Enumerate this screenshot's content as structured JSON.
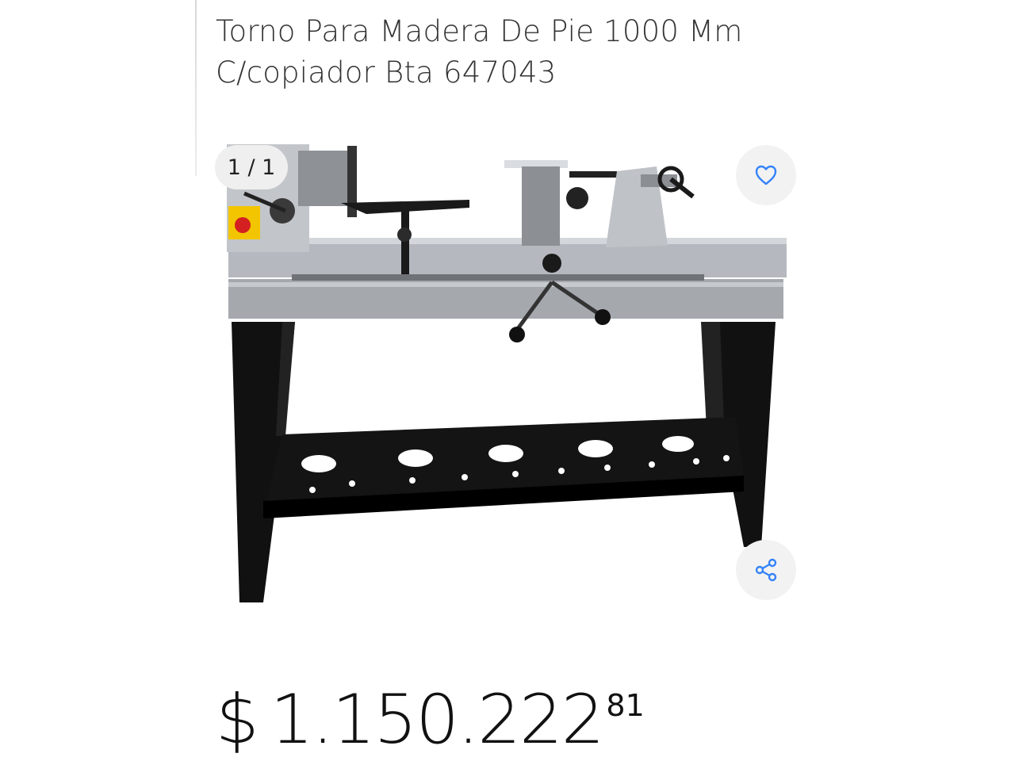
{
  "product": {
    "title_line1": "Torno Para Madera De Pie 1000 Mm",
    "title_line2": "C/copiador Bta 647043",
    "image_alt": "Torno para madera de pie con copiador"
  },
  "gallery": {
    "counter": "1 / 1"
  },
  "actions": {
    "favorite_icon": "heart-icon",
    "share_icon": "share-icon"
  },
  "price": {
    "currency": "$",
    "amount": "1.150.222",
    "cents": "81"
  },
  "colors": {
    "accent": "#3483fa",
    "text": "#333333",
    "button_bg": "#f2f2f2"
  }
}
